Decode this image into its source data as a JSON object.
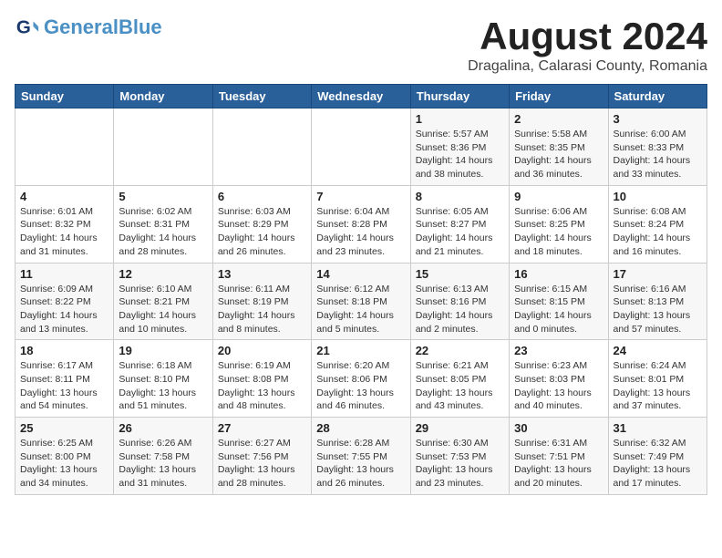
{
  "header": {
    "logo_line1": "General",
    "logo_line2": "Blue",
    "title": "August 2024",
    "subtitle": "Dragalina, Calarasi County, Romania"
  },
  "weekdays": [
    "Sunday",
    "Monday",
    "Tuesday",
    "Wednesday",
    "Thursday",
    "Friday",
    "Saturday"
  ],
  "weeks": [
    [
      {
        "day": "",
        "info": ""
      },
      {
        "day": "",
        "info": ""
      },
      {
        "day": "",
        "info": ""
      },
      {
        "day": "",
        "info": ""
      },
      {
        "day": "1",
        "info": "Sunrise: 5:57 AM\nSunset: 8:36 PM\nDaylight: 14 hours\nand 38 minutes."
      },
      {
        "day": "2",
        "info": "Sunrise: 5:58 AM\nSunset: 8:35 PM\nDaylight: 14 hours\nand 36 minutes."
      },
      {
        "day": "3",
        "info": "Sunrise: 6:00 AM\nSunset: 8:33 PM\nDaylight: 14 hours\nand 33 minutes."
      }
    ],
    [
      {
        "day": "4",
        "info": "Sunrise: 6:01 AM\nSunset: 8:32 PM\nDaylight: 14 hours\nand 31 minutes."
      },
      {
        "day": "5",
        "info": "Sunrise: 6:02 AM\nSunset: 8:31 PM\nDaylight: 14 hours\nand 28 minutes."
      },
      {
        "day": "6",
        "info": "Sunrise: 6:03 AM\nSunset: 8:29 PM\nDaylight: 14 hours\nand 26 minutes."
      },
      {
        "day": "7",
        "info": "Sunrise: 6:04 AM\nSunset: 8:28 PM\nDaylight: 14 hours\nand 23 minutes."
      },
      {
        "day": "8",
        "info": "Sunrise: 6:05 AM\nSunset: 8:27 PM\nDaylight: 14 hours\nand 21 minutes."
      },
      {
        "day": "9",
        "info": "Sunrise: 6:06 AM\nSunset: 8:25 PM\nDaylight: 14 hours\nand 18 minutes."
      },
      {
        "day": "10",
        "info": "Sunrise: 6:08 AM\nSunset: 8:24 PM\nDaylight: 14 hours\nand 16 minutes."
      }
    ],
    [
      {
        "day": "11",
        "info": "Sunrise: 6:09 AM\nSunset: 8:22 PM\nDaylight: 14 hours\nand 13 minutes."
      },
      {
        "day": "12",
        "info": "Sunrise: 6:10 AM\nSunset: 8:21 PM\nDaylight: 14 hours\nand 10 minutes."
      },
      {
        "day": "13",
        "info": "Sunrise: 6:11 AM\nSunset: 8:19 PM\nDaylight: 14 hours\nand 8 minutes."
      },
      {
        "day": "14",
        "info": "Sunrise: 6:12 AM\nSunset: 8:18 PM\nDaylight: 14 hours\nand 5 minutes."
      },
      {
        "day": "15",
        "info": "Sunrise: 6:13 AM\nSunset: 8:16 PM\nDaylight: 14 hours\nand 2 minutes."
      },
      {
        "day": "16",
        "info": "Sunrise: 6:15 AM\nSunset: 8:15 PM\nDaylight: 14 hours\nand 0 minutes."
      },
      {
        "day": "17",
        "info": "Sunrise: 6:16 AM\nSunset: 8:13 PM\nDaylight: 13 hours\nand 57 minutes."
      }
    ],
    [
      {
        "day": "18",
        "info": "Sunrise: 6:17 AM\nSunset: 8:11 PM\nDaylight: 13 hours\nand 54 minutes."
      },
      {
        "day": "19",
        "info": "Sunrise: 6:18 AM\nSunset: 8:10 PM\nDaylight: 13 hours\nand 51 minutes."
      },
      {
        "day": "20",
        "info": "Sunrise: 6:19 AM\nSunset: 8:08 PM\nDaylight: 13 hours\nand 48 minutes."
      },
      {
        "day": "21",
        "info": "Sunrise: 6:20 AM\nSunset: 8:06 PM\nDaylight: 13 hours\nand 46 minutes."
      },
      {
        "day": "22",
        "info": "Sunrise: 6:21 AM\nSunset: 8:05 PM\nDaylight: 13 hours\nand 43 minutes."
      },
      {
        "day": "23",
        "info": "Sunrise: 6:23 AM\nSunset: 8:03 PM\nDaylight: 13 hours\nand 40 minutes."
      },
      {
        "day": "24",
        "info": "Sunrise: 6:24 AM\nSunset: 8:01 PM\nDaylight: 13 hours\nand 37 minutes."
      }
    ],
    [
      {
        "day": "25",
        "info": "Sunrise: 6:25 AM\nSunset: 8:00 PM\nDaylight: 13 hours\nand 34 minutes."
      },
      {
        "day": "26",
        "info": "Sunrise: 6:26 AM\nSunset: 7:58 PM\nDaylight: 13 hours\nand 31 minutes."
      },
      {
        "day": "27",
        "info": "Sunrise: 6:27 AM\nSunset: 7:56 PM\nDaylight: 13 hours\nand 28 minutes."
      },
      {
        "day": "28",
        "info": "Sunrise: 6:28 AM\nSunset: 7:55 PM\nDaylight: 13 hours\nand 26 minutes."
      },
      {
        "day": "29",
        "info": "Sunrise: 6:30 AM\nSunset: 7:53 PM\nDaylight: 13 hours\nand 23 minutes."
      },
      {
        "day": "30",
        "info": "Sunrise: 6:31 AM\nSunset: 7:51 PM\nDaylight: 13 hours\nand 20 minutes."
      },
      {
        "day": "31",
        "info": "Sunrise: 6:32 AM\nSunset: 7:49 PM\nDaylight: 13 hours\nand 17 minutes."
      }
    ]
  ]
}
